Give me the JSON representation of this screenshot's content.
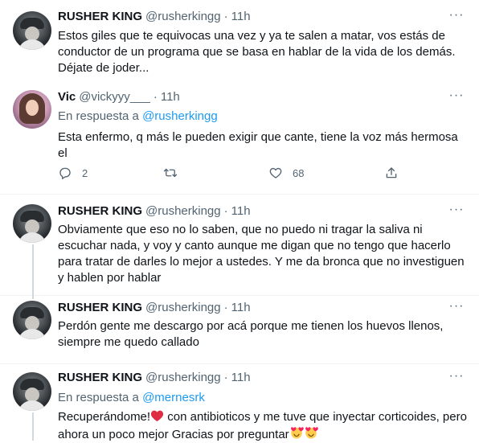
{
  "tweets": [
    {
      "name": "RUSHER KING",
      "handle": "@rusherkingg",
      "dot": "·",
      "time": "11h",
      "text": "Estos giles que te equivocas una vez y ya te salen a matar, vos estás de conductor de un programa que se basa en hablar de la vida de los demás. Déjate de joder..."
    },
    {
      "name": "Vic",
      "handle": "@vickyyy___",
      "dot": "·",
      "time": "11h",
      "reply_prefix": "En respuesta a",
      "reply_to": "@rusherkingg",
      "text": "Esta enfermo, q más le pueden exigir que cante, tiene la voz más hermosa el",
      "replies": "2",
      "likes": "68"
    },
    {
      "name": "RUSHER KING",
      "handle": "@rusherkingg",
      "dot": "·",
      "time": "11h",
      "text": "Obviamente que eso no lo saben, que no puedo ni tragar la saliva ni escuchar nada, y voy y canto aunque me digan que no tengo que hacerlo para tratar de darles lo mejor a ustedes. Y me da bronca que no investiguen y hablen por hablar"
    },
    {
      "name": "RUSHER KING",
      "handle": "@rusherkingg",
      "dot": "·",
      "time": "11h",
      "text": "Perdón gente me descargo por acá porque me tienen los huevos llenos, siempre me quedo callado"
    },
    {
      "name": "RUSHER KING",
      "handle": "@rusherkingg",
      "dot": "·",
      "time": "11h",
      "reply_prefix": "En respuesta a",
      "reply_to": "@mernesrk",
      "text_part1": "Recuperándome!",
      "text_part2": " con antibioticos y me tuve que inyectar corticoides, pero ahora un poco mejor Gracias por preguntar"
    }
  ],
  "icons": {
    "more": "more-horizontal-icon",
    "reply": "reply-icon",
    "retweet": "retweet-icon",
    "like": "like-icon",
    "share": "share-icon",
    "heart_emoji": "red-heart-emoji",
    "smiling_heart_emoji": "smiling-face-with-hearts-emoji"
  },
  "colors": {
    "link": "#1d9bf0",
    "secondary_text": "#536471",
    "thread_line": "#cfd9de"
  }
}
